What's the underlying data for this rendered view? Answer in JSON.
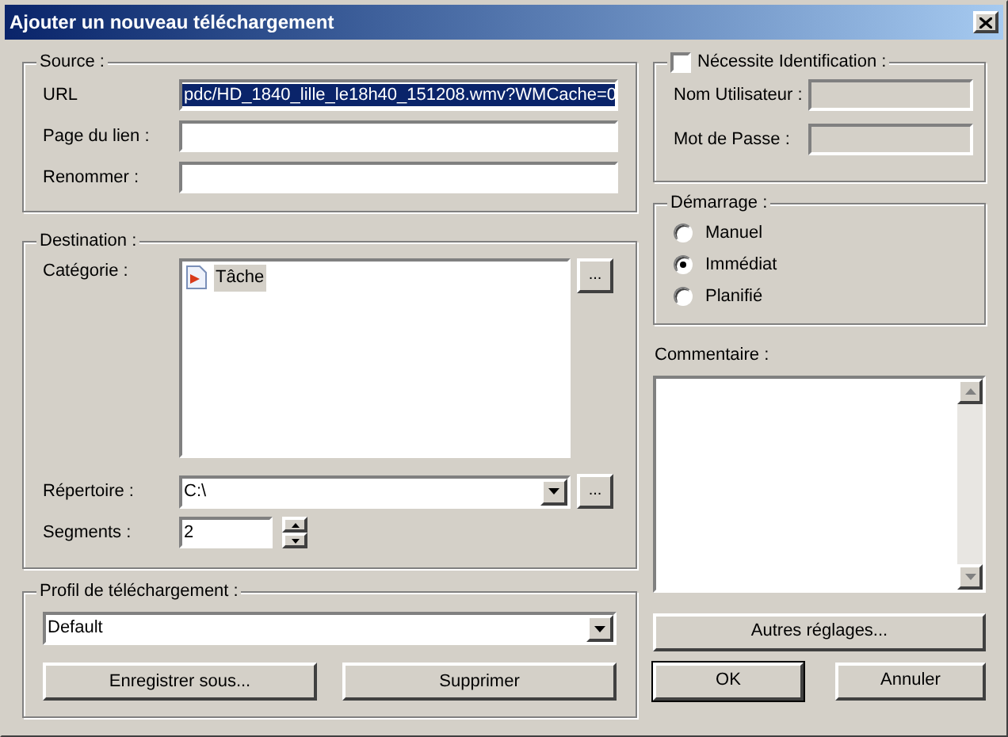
{
  "window": {
    "title": "Ajouter un nouveau téléchargement"
  },
  "source": {
    "legend": "Source :",
    "url_text_selected": true,
    "fields": [
      {
        "label": "URL",
        "value": "pdc/HD_1840_lille_le18h40_151208.wmv?WMCache=0"
      },
      {
        "label": "Page du lien :"
      },
      {
        "label": "Renommer :"
      }
    ]
  },
  "destination": {
    "legend": "Destination :",
    "category_label": "Catégorie :",
    "categories": [
      {
        "label": "Tâche",
        "selected": true
      }
    ],
    "category_browse": "...",
    "directory_label": "Répertoire :",
    "directory": "C:\\",
    "directory_browse": "...",
    "segments_label": "Segments :",
    "segments": "2"
  },
  "profile": {
    "legend": "Profil de téléchargement :",
    "value": "Default",
    "buttons": [
      "Enregistrer sous...",
      "Supprimer"
    ]
  },
  "auth": {
    "label": "Nécessite Identification :",
    "checked": false,
    "fields": [
      {
        "label": "Nom Utilisateur :",
        "disabled": true
      },
      {
        "label": "Mot de Passe :",
        "disabled": true
      }
    ]
  },
  "startup": {
    "legend": "Démarrage :",
    "options": [
      {
        "label": "Manuel",
        "selected": false
      },
      {
        "label": "Immédiat",
        "selected": true
      },
      {
        "label": "Planifié",
        "selected": false
      }
    ]
  },
  "comment": {
    "label": "Commentaire :"
  },
  "more_button": "Autres réglages...",
  "ok_button": {
    "label": "OK",
    "default": true
  },
  "cancel_button": "Annuler"
}
